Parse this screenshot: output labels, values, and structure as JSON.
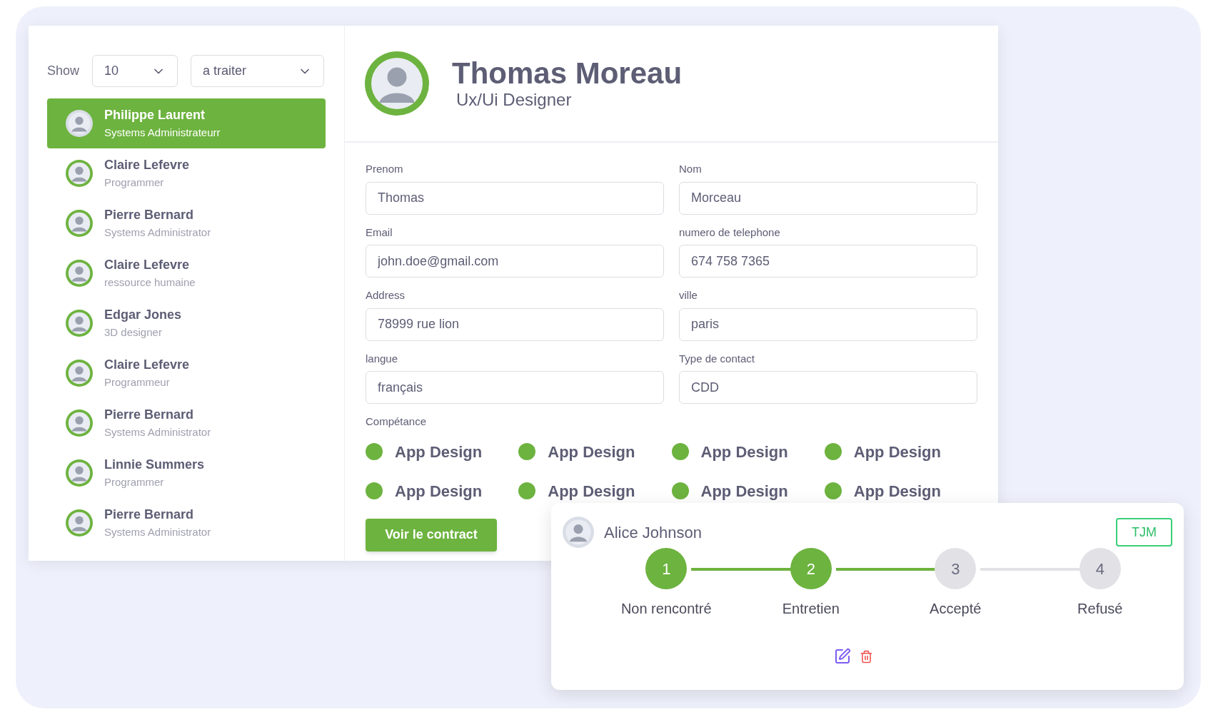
{
  "filters": {
    "show_label": "Show",
    "per_page": "10",
    "status": "a traiter"
  },
  "people": [
    {
      "name": "Philippe Laurent",
      "role": "Systems Administrateurr",
      "selected": true
    },
    {
      "name": "Claire Lefevre",
      "role": "Programmer",
      "selected": false
    },
    {
      "name": "Pierre Bernard",
      "role": "Systems Administrator",
      "selected": false
    },
    {
      "name": "Claire Lefevre",
      "role": "ressource humaine",
      "selected": false
    },
    {
      "name": "Edgar Jones",
      "role": "3D designer",
      "selected": false
    },
    {
      "name": "Claire Lefevre",
      "role": "Programmeur",
      "selected": false
    },
    {
      "name": "Pierre Bernard",
      "role": "Systems Administrator",
      "selected": false
    },
    {
      "name": "Linnie Summers",
      "role": "Programmer",
      "selected": false
    },
    {
      "name": "Pierre Bernard",
      "role": "Systems Administrator",
      "selected": false
    }
  ],
  "profile": {
    "name": "Thomas Moreau",
    "title": "Ux/Ui Designer"
  },
  "fields": [
    {
      "label": "Prenom",
      "value": "Thomas"
    },
    {
      "label": "Nom",
      "value": "Morceau"
    },
    {
      "label": "Email",
      "value": "john.doe@gmail.com"
    },
    {
      "label": "numero de telephone",
      "value": "674 758 7365"
    },
    {
      "label": "Address",
      "value": "78999 rue lion"
    },
    {
      "label": "ville",
      "value": "paris"
    },
    {
      "label": "langue",
      "value": "français"
    },
    {
      "label": "Type de contact",
      "value": "CDD"
    }
  ],
  "skills_label": "Compétance",
  "skills": [
    "App Design",
    "App Design",
    "App Design",
    "App Design",
    "App Design",
    "App Design",
    "App Design",
    "App Design"
  ],
  "contract_button": "Voir le contract",
  "candidate_card": {
    "name": "Alice Johnson",
    "badge": "TJM",
    "steps": [
      {
        "number": "1",
        "label": "Non rencontré",
        "done": true
      },
      {
        "number": "2",
        "label": "Entretien",
        "done": true
      },
      {
        "number": "3",
        "label": "Accepté",
        "done": false
      },
      {
        "number": "4",
        "label": "Refusé",
        "done": false
      }
    ]
  }
}
